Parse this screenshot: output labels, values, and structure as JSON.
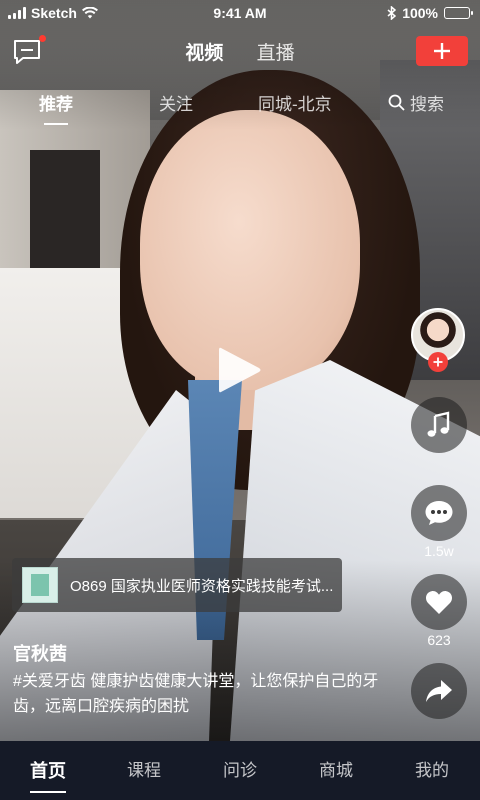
{
  "status_bar": {
    "carrier": "Sketch",
    "time": "9:41 AM",
    "battery_percent": "100%"
  },
  "top_bar": {
    "tabs": [
      {
        "label": "视频",
        "active": true
      },
      {
        "label": "直播",
        "active": false
      }
    ],
    "add_button_icon": "plus-icon"
  },
  "sub_tabs": {
    "items": [
      "推荐",
      "关注",
      "同城-北京"
    ],
    "active_index": 0,
    "search_label": "搜索"
  },
  "video": {
    "playing": false,
    "course_card": {
      "title": "O869 国家执业医师资格实践技能考试..."
    },
    "author_name": "官秋茜",
    "caption": "#关爱牙齿 健康护齿健康大讲堂，让您保护自己的牙齿，远离口腔疾病的困扰"
  },
  "actions": {
    "comment_count": "1.5w",
    "like_count": "623"
  },
  "bottom_nav": {
    "items": [
      "首页",
      "课程",
      "问诊",
      "商城",
      "我的"
    ],
    "active_index": 0
  },
  "colors": {
    "accent_red": "#f2403a",
    "nav_background": "#151a27"
  }
}
